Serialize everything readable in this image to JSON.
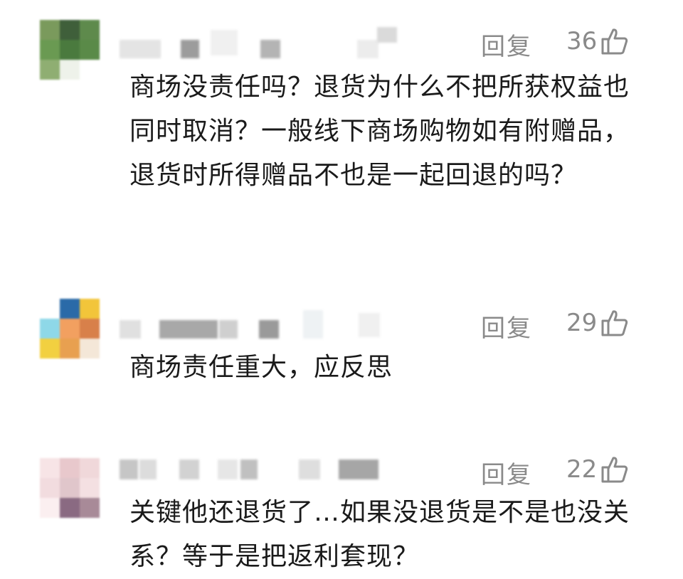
{
  "comments": [
    {
      "reply_label": "回复",
      "like_count": "36",
      "text": "商场没责任吗？退货为什么不把所获权益也同时取消？一般线下商场购物如有附赠品，退货时所得赠品不也是一起回退的吗？"
    },
    {
      "reply_label": "回复",
      "like_count": "29",
      "text": "商场责任重大，应反思"
    },
    {
      "reply_label": "回复",
      "like_count": "22",
      "text": "关键他还退货了…如果没退货是不是也没关系？等于是把返利套现？"
    }
  ],
  "icons": {
    "like": "thumbs-up-icon"
  },
  "colors": {
    "meta": "#8a8a8a",
    "text": "#1a1a1a"
  },
  "avatars": [
    {
      "blurred": true,
      "palette": [
        "#7a9a5c",
        "#3f5f3a",
        "#5e8a4c",
        "#6a9a52",
        "#4a7a3e",
        "#5a8a48",
        "#8fae72",
        "#eef2ea",
        "#ffffff"
      ]
    },
    {
      "blurred": true,
      "palette": [
        "#ffffff",
        "#2a6aa8",
        "#f2c53a",
        "#8ed8e8",
        "#f2a060",
        "#d8804a",
        "#f2d040",
        "#e8a050",
        "#f4e7d8"
      ]
    },
    {
      "blurred": true,
      "palette": [
        "#f7e4e6",
        "#e8c8cc",
        "#f0d8da",
        "#f2dcdf",
        "#e0c6cb",
        "#f4e0e2",
        "#fbeff0",
        "#8a6a82",
        "#a88a98"
      ]
    }
  ]
}
